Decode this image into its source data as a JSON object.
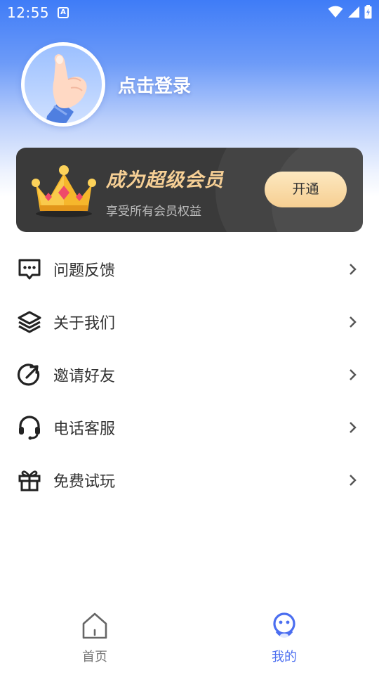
{
  "status_bar": {
    "time": "12:55",
    "notification_icon": "app-notification-icon",
    "icons": [
      "wifi-icon",
      "cell-signal-icon",
      "battery-icon"
    ]
  },
  "profile": {
    "login_label": "点击登录",
    "avatar_icon": "hand-gesture-avatar"
  },
  "vip_card": {
    "title": "成为超级会员",
    "subtitle": "享受所有会员权益",
    "button_label": "开通",
    "crown_icon": "crown-icon"
  },
  "menu": {
    "items": [
      {
        "label": "问题反馈",
        "icon": "chat-bubble-icon"
      },
      {
        "label": "关于我们",
        "icon": "layers-icon"
      },
      {
        "label": "邀请好友",
        "icon": "share-arrow-icon"
      },
      {
        "label": "电话客服",
        "icon": "headset-icon"
      },
      {
        "label": "免费试玩",
        "icon": "gift-icon"
      }
    ]
  },
  "tabbar": {
    "tabs": [
      {
        "label": "首页",
        "icon": "home-icon",
        "active": false
      },
      {
        "label": "我的",
        "icon": "profile-face-icon",
        "active": true
      }
    ]
  },
  "colors": {
    "accent": "#4b6ef0",
    "vip_gold": "#f6cf95",
    "header_blue": "#3f7cf7"
  }
}
